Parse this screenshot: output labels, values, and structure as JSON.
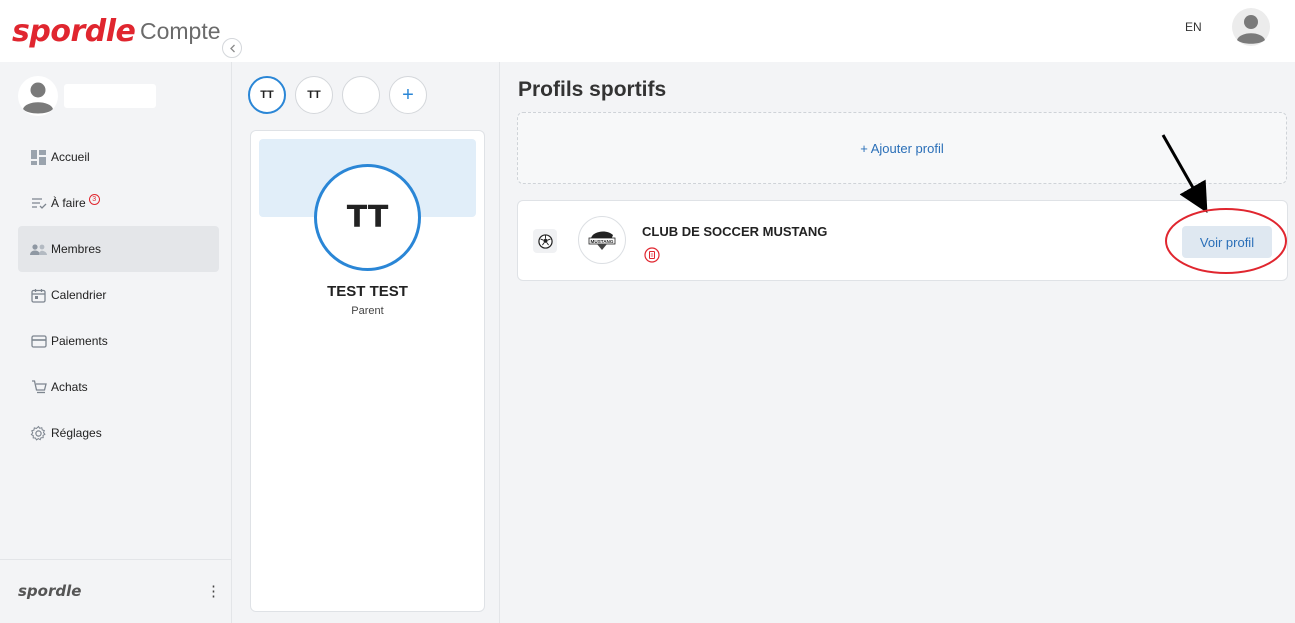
{
  "header": {
    "logo": "spordle",
    "title": "Compte",
    "language": "EN"
  },
  "sidebar": {
    "items": [
      {
        "label": "Accueil",
        "icon": "dashboard-icon"
      },
      {
        "label": "À faire",
        "icon": "checklist-icon",
        "badge": "3"
      },
      {
        "label": "Membres",
        "icon": "members-icon",
        "active": true
      },
      {
        "label": "Calendrier",
        "icon": "calendar-icon"
      },
      {
        "label": "Paiements",
        "icon": "credit-card-icon"
      },
      {
        "label": "Achats",
        "icon": "cart-icon"
      },
      {
        "label": "Réglages",
        "icon": "gear-icon"
      }
    ],
    "footer_logo": "spordle",
    "footer_menu": "⋮"
  },
  "members": {
    "chips": [
      "TT",
      "TT"
    ],
    "add_label": "+",
    "selected": {
      "initials": "TT",
      "name": "TEST TEST",
      "role": "Parent"
    }
  },
  "main": {
    "title": "Profils sportifs",
    "add_profile_label": "+ Ajouter profil",
    "profiles": [
      {
        "club_name": "CLUB DE SOCCER MUSTANG",
        "logo_text": "MUSTANG",
        "sport_icon": "soccer-ball-icon",
        "action_label": "Voir profil"
      }
    ]
  },
  "colors": {
    "brand": "#e0262f",
    "accent": "#2a86d6",
    "link": "#2a6fb8",
    "annotation": "#e0262f"
  }
}
